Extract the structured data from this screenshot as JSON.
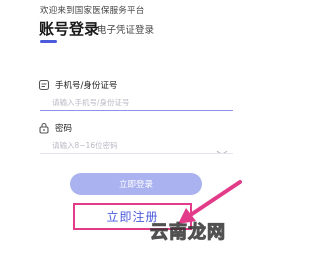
{
  "header": {
    "welcome_text": "欢迎来到国家医保服务平台"
  },
  "tabs": [
    {
      "label": "账号登录",
      "active": true
    },
    {
      "label": "电子凭证登录",
      "active": false
    }
  ],
  "form": {
    "account": {
      "label": "手机号/身份证号",
      "placeholder": "请输入手机号/身份证号",
      "icon": "account-card-icon"
    },
    "password": {
      "label": "密码",
      "placeholder": "请输入8~16位密码",
      "icon": "lock-icon",
      "toggle_icon": "eye-closed-icon"
    }
  },
  "actions": {
    "login_label": "立即登录",
    "register_label": "立即注册"
  },
  "overlay": {
    "watermark": "云南龙网"
  },
  "colors": {
    "accent": "#4b5bdc",
    "login_button": "#aab2ef",
    "highlight": "#e23b8a"
  }
}
